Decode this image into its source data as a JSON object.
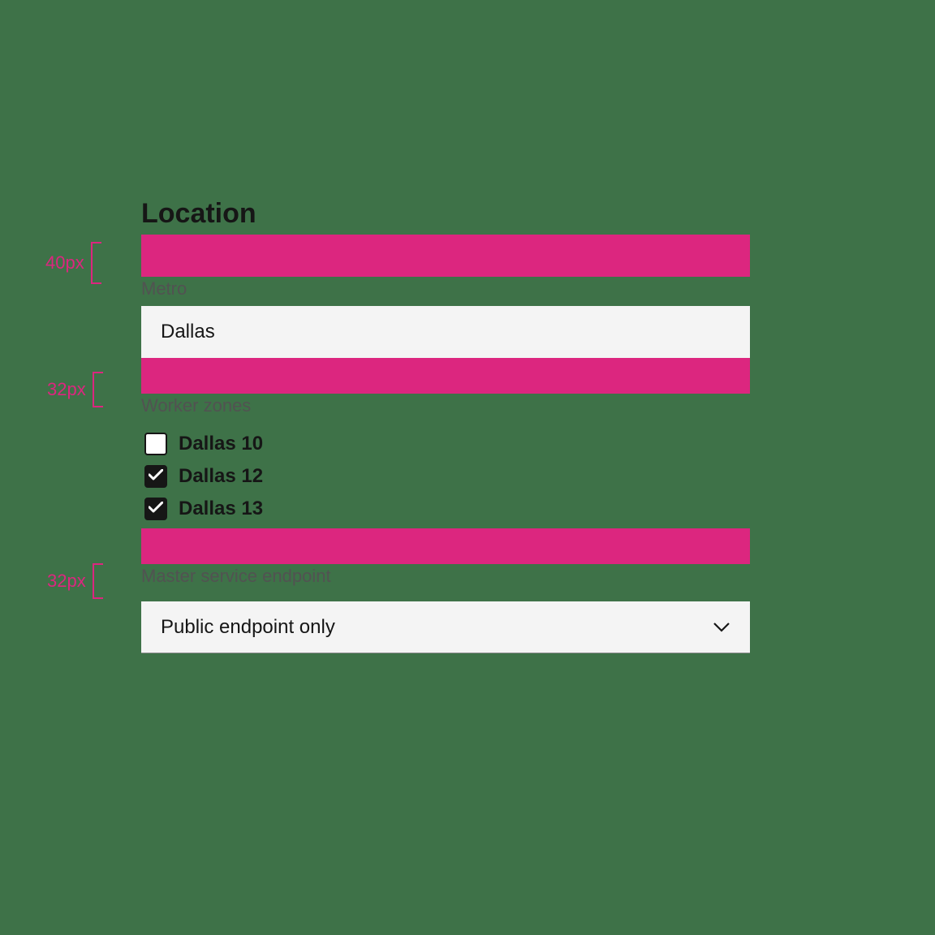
{
  "section_title": "Location",
  "spacers": {
    "a_label": "40px",
    "b_label": "32px",
    "c_label": "32px"
  },
  "metro": {
    "label": "Metro",
    "value": "Dallas"
  },
  "worker_zones": {
    "label": "Worker zones",
    "items": [
      {
        "label": "Dallas 10",
        "checked": false
      },
      {
        "label": "Dallas 12",
        "checked": true
      },
      {
        "label": "Dallas 13",
        "checked": true
      }
    ]
  },
  "endpoint": {
    "label": "Master service endpoint",
    "value": "Public endpoint only"
  }
}
